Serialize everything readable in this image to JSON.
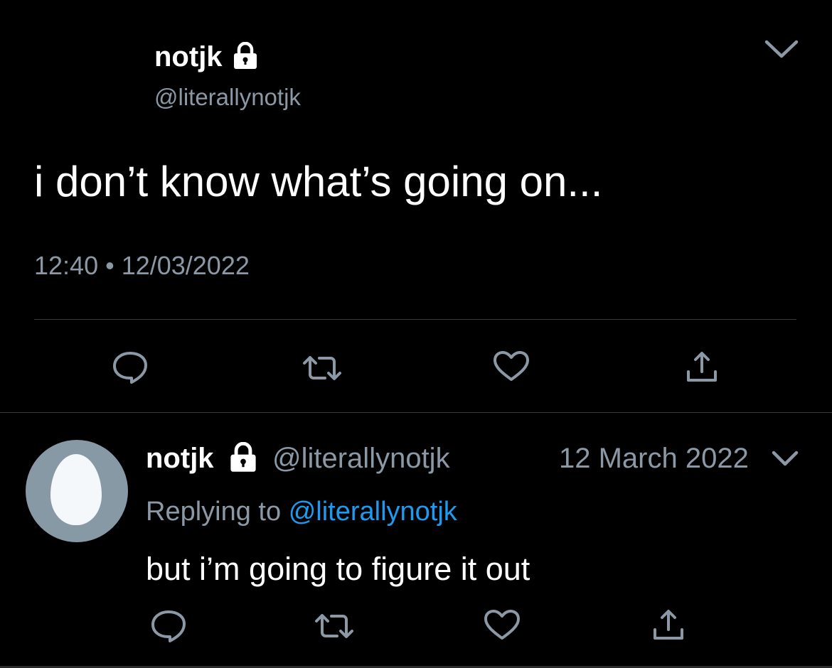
{
  "main_tweet": {
    "display_name": "notjk",
    "handle": "@literallynotjk",
    "text": "i don’t know what’s going on...",
    "timestamp": "12:40 • 12/03/2022",
    "icons": {
      "lock": "lock-icon",
      "menu": "chevron-down-icon",
      "actions": [
        "reply-icon",
        "retweet-icon",
        "like-icon",
        "share-icon"
      ]
    }
  },
  "reply_tweet": {
    "display_name": "notjk",
    "handle": "@literallynotjk",
    "date": "12 March 2022",
    "replying_prefix": "Replying to",
    "replying_mention": "@literallynotjk",
    "text": "but i’m going to figure it out",
    "avatar": "default-egg-avatar"
  },
  "colors": {
    "background": "#000000",
    "text": "#ffffff",
    "secondary_text": "#8b98a5",
    "link": "#1d9bf0",
    "divider": "#3a3a3c",
    "avatar_bg": "#8899a6"
  }
}
